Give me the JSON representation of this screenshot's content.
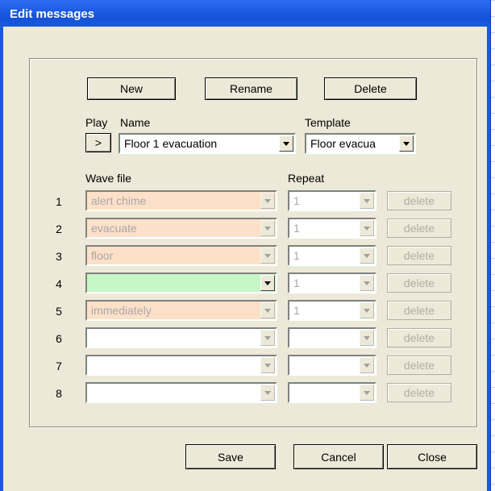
{
  "window": {
    "title": "Edit messages"
  },
  "toolbar": {
    "new_label": "New",
    "rename_label": "Rename",
    "delete_label": "Delete"
  },
  "labels": {
    "play": "Play",
    "name": "Name",
    "template": "Template",
    "wave_file": "Wave file",
    "repeat": "Repeat"
  },
  "play_button": ">",
  "name_select": {
    "value": "Floor 1 evacuation"
  },
  "template_select": {
    "value": "Floor evacua"
  },
  "rows": [
    {
      "num": "1",
      "wave": "alert chime",
      "repeat": "1",
      "delete": "delete"
    },
    {
      "num": "2",
      "wave": "evacuate",
      "repeat": "1",
      "delete": "delete"
    },
    {
      "num": "3",
      "wave": "floor",
      "repeat": "1",
      "delete": "delete"
    },
    {
      "num": "4",
      "wave": "",
      "repeat": "1",
      "delete": "delete"
    },
    {
      "num": "5",
      "wave": "immediately",
      "repeat": "1",
      "delete": "delete"
    },
    {
      "num": "6",
      "wave": "",
      "repeat": "",
      "delete": "delete"
    },
    {
      "num": "7",
      "wave": "",
      "repeat": "",
      "delete": "delete"
    },
    {
      "num": "8",
      "wave": "",
      "repeat": "",
      "delete": "delete"
    }
  ],
  "footer": {
    "save_label": "Save",
    "cancel_label": "Cancel",
    "close_label": "Close"
  },
  "colors": {
    "title_bar": "#1a5ae0",
    "dialog_bg": "#ece9d8",
    "filled_row": "#fde0c8",
    "active_row": "#c6f7c6"
  }
}
